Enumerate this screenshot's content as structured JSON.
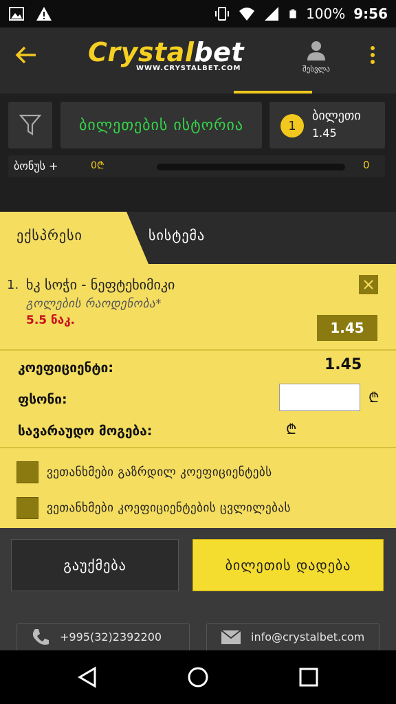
{
  "status_bar": {
    "battery": "100%",
    "time": "9:56",
    "icons": [
      "image-icon",
      "warning-icon",
      "vibrate-icon",
      "wifi-icon",
      "signal-icon",
      "battery-icon"
    ]
  },
  "header": {
    "logo_main": "Crystal",
    "logo_accent": "bet",
    "logo_sub": "WWW.CRYSTALBET.COM",
    "login_label": "შესვლა"
  },
  "summary": {
    "history_label": "ბილეთების ისტორია",
    "ticket_count": "1",
    "ticket_label": "ბილეთი",
    "ticket_value": "1.45",
    "bonus_label": "ბონუს +",
    "bonus_amount": "0₾",
    "bonus_count": "0",
    "bonus_progress": 0
  },
  "slip": {
    "tabs": [
      "ექსპრესი",
      "სისტემა"
    ],
    "active_tab": "ექსპრესი",
    "event": {
      "index": "1.",
      "name": "ხკ სოჭი - ნეფტეხიმიკი",
      "market": "გოლების რაოდენობა*",
      "outcome": "5.5 ნაკ.",
      "odd": "1.45"
    },
    "coef_label": "კოეფიციენტი:",
    "coef_value": "1.45",
    "stake_label": "ფსონი:",
    "stake_value": "",
    "potential_label": "სავარაუდო მოგება:",
    "currency": "₾",
    "options": [
      "ვეთანხმები გაზრდილ კოეფიციენტებს",
      "ვეთანხმები კოეფიციენტების ცვლილებას"
    ]
  },
  "actions": {
    "cancel_label": "გაუქმება",
    "place_label": "ბილეთის დადება"
  },
  "contacts": {
    "phone": "+995(32)2392200",
    "email": "info@crystalbet.com"
  },
  "colors": {
    "accent": "#f2c81f",
    "slip_bg": "#f5dd60",
    "odd_bg": "#8a7a10",
    "history_text": "#35d54a",
    "outcome_text": "#c8101e"
  }
}
